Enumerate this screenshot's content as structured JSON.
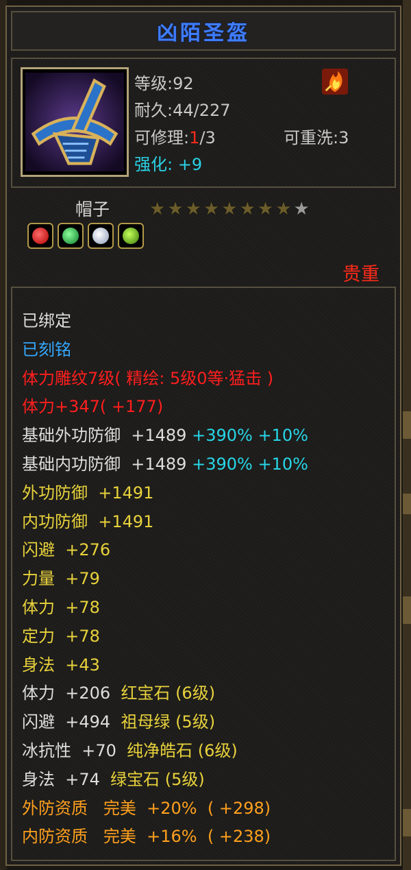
{
  "item": {
    "name": "凶陌圣盔",
    "level_label": "等级:92",
    "durability_label": "耐久:44/227",
    "repair_label_prefix": "可修理:",
    "repair_current": "1",
    "repair_max": "/3",
    "rewash_label": "可重洗:3",
    "enhance_label": "强化: +9",
    "type": "帽子",
    "stars_filled": 8,
    "stars_total": 9,
    "rarity": "贵重",
    "icons": [
      "helmet-icon",
      "flame-icon",
      "ruby-gem-icon",
      "emerald-gem-icon",
      "diamond-gem-icon",
      "green-gem-icon"
    ]
  },
  "attributes": {
    "bound": "已绑定",
    "engraved": "已刻铭",
    "carving": "体力雕纹7级( 精绘: 5级0等·猛击 )",
    "stamina_bonus": "体力+347( +177)",
    "base_ext_def": {
      "label": "基础外功防御  +1489",
      "pct1": " +390%",
      "pct2": " +10%"
    },
    "base_int_def": {
      "label": "基础内功防御  +1489",
      "pct1": " +390%",
      "pct2": " +10%"
    },
    "ext_def": "外功防御  +1491",
    "int_def": "内功防御  +1491",
    "dodge": "闪避  +276",
    "strength": "力量  +79",
    "stamina": "体力  +78",
    "focus": "定力  +78",
    "agility": "身法  +43",
    "gem1_stat": "体力  +206",
    "gem1_name": "  红宝石 (6级)",
    "gem2_stat": "闪避  +494",
    "gem2_name": "  祖母绿 (5级)",
    "gem3_stat": "冰抗性  +70",
    "gem3_name": "  纯净皓石 (6级)",
    "gem4_stat": "身法  +74",
    "gem4_name": "  绿宝石 (5级)",
    "ext_aptitude": "外防资质   完美  +20%  ( +298)",
    "int_aptitude": "内防资质   完美  +16%  ( +238)"
  },
  "colors": {
    "title": "#3f7dff",
    "rarity": "#ff2a1a",
    "enhance": "#2ad2e6",
    "bound": "#dedede",
    "engraved": "#34a8ff",
    "carving": "#ff1e1e",
    "attribute": "#e8d23c",
    "aptitude": "#ffa01e"
  }
}
